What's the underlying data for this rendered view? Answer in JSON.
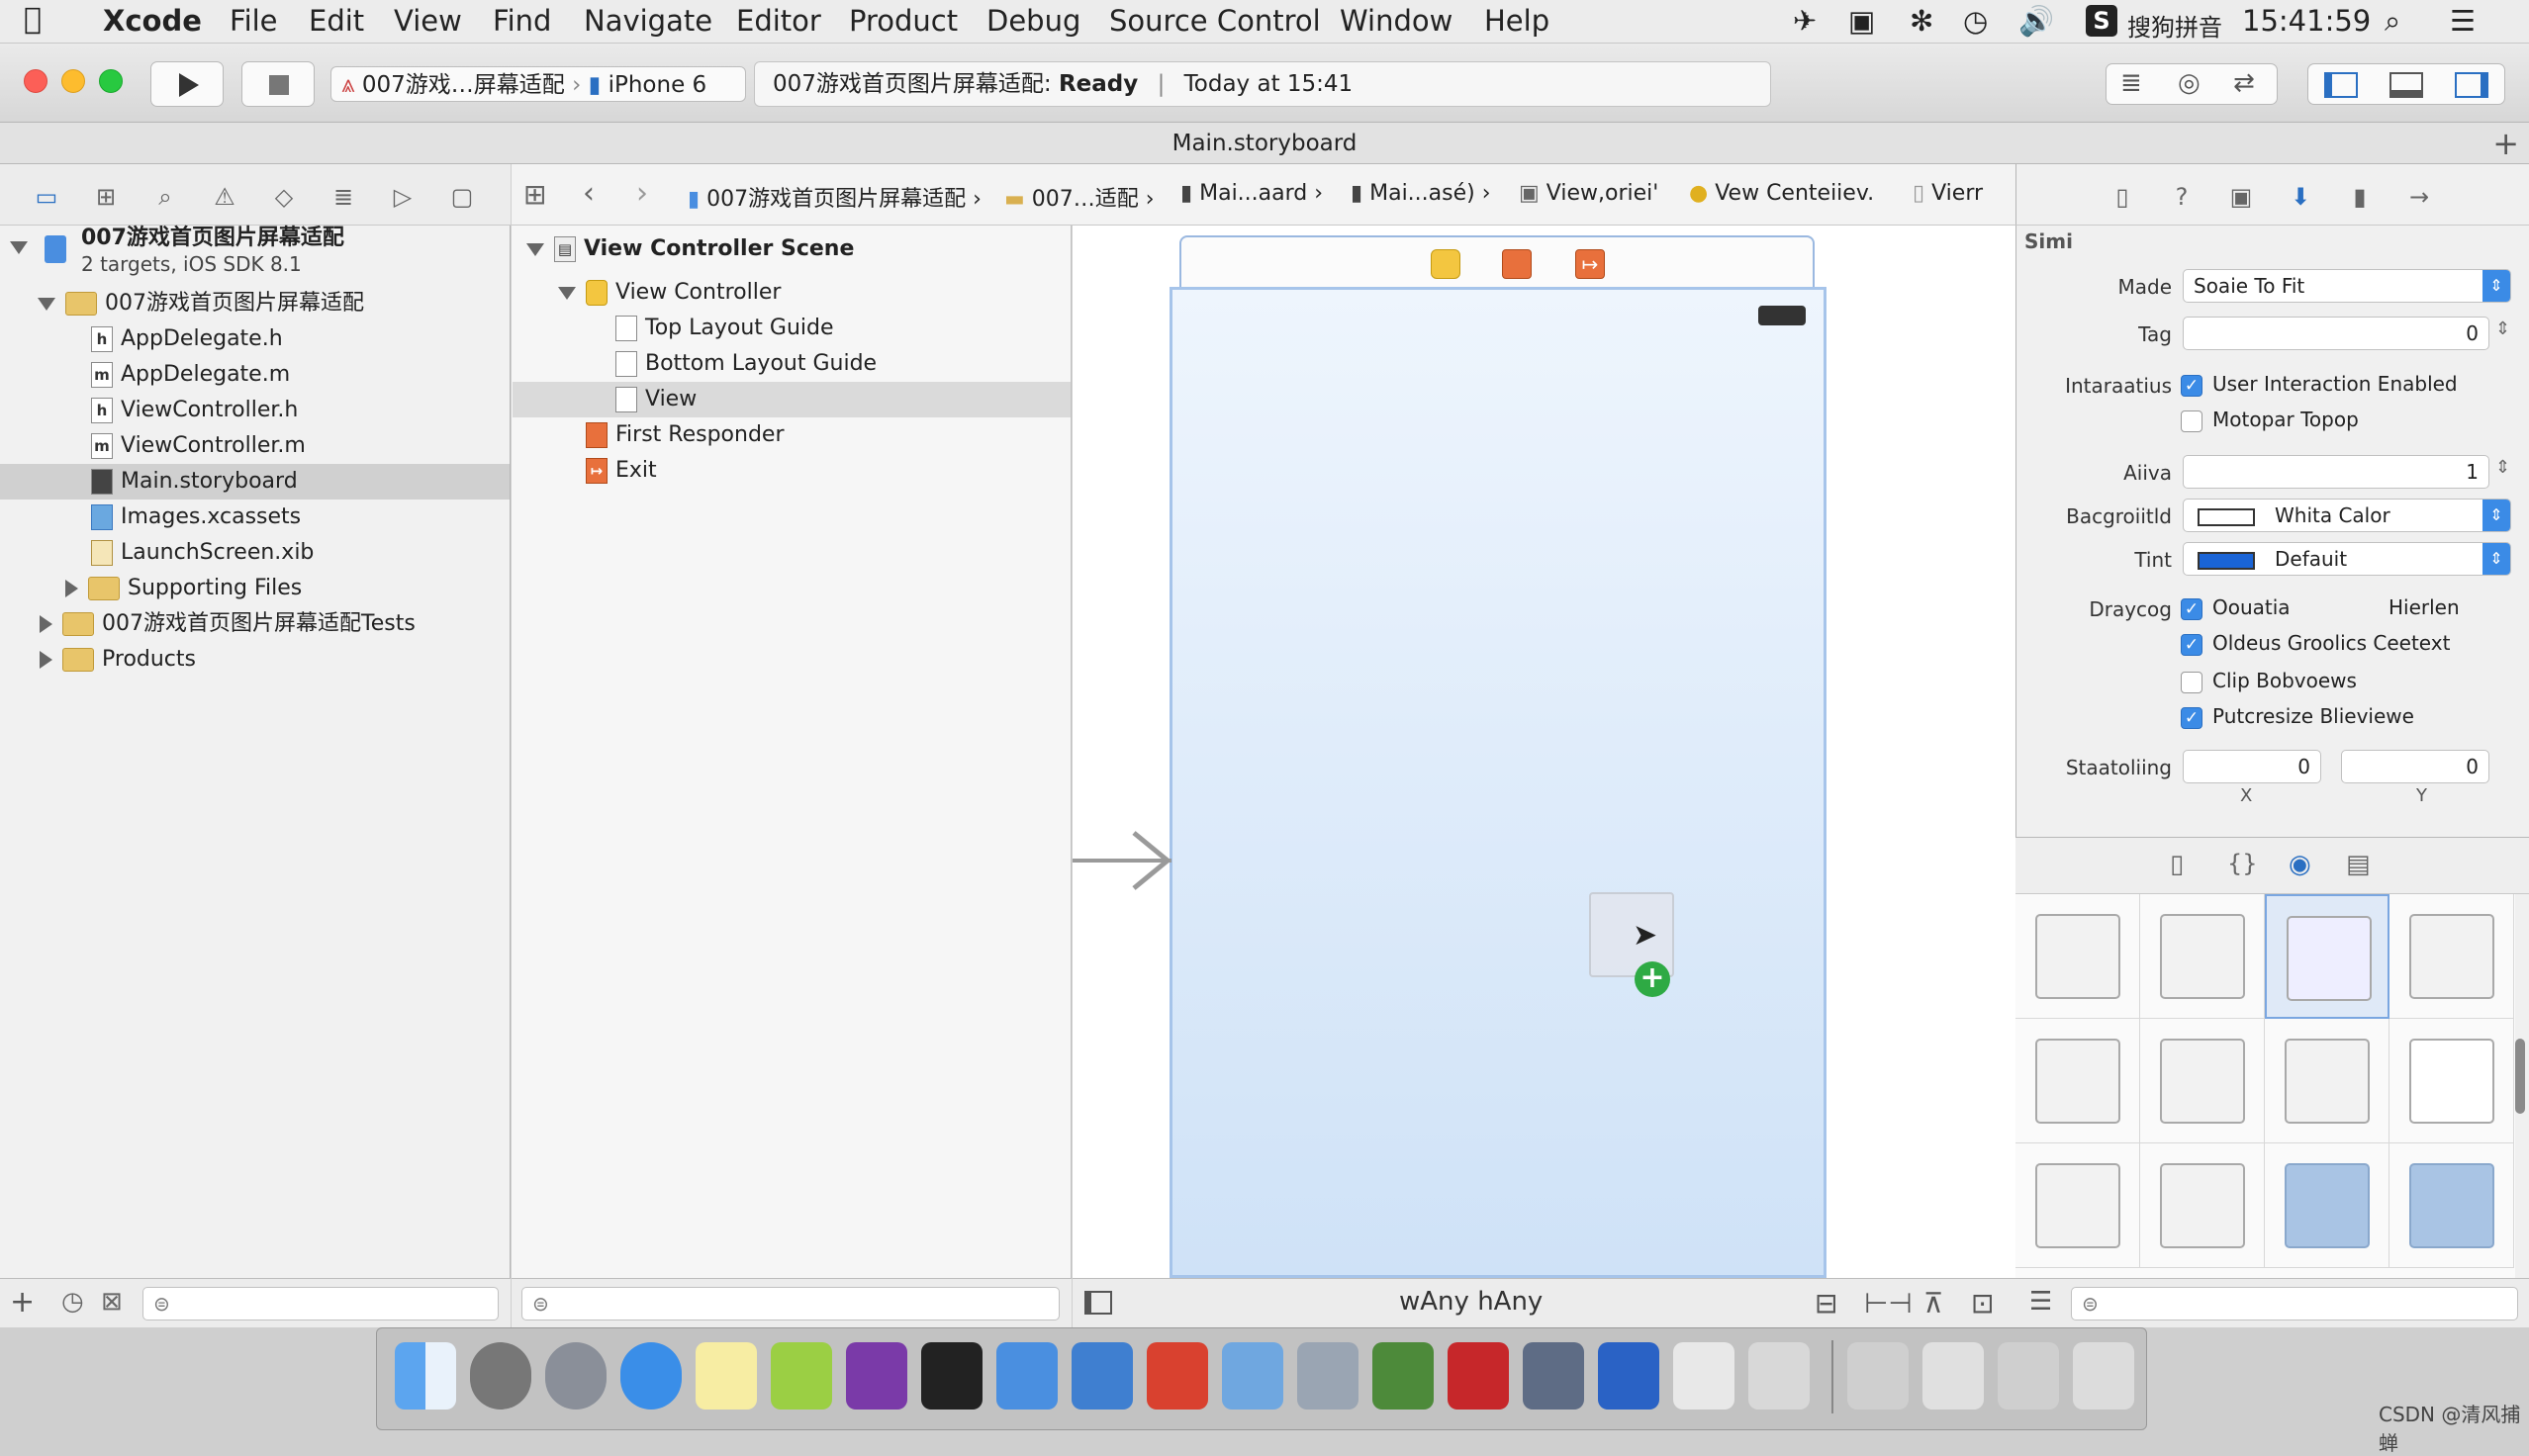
{
  "menubar": {
    "app": "Xcode",
    "items": [
      "File",
      "Edit",
      "View",
      "Find",
      "Navigate",
      "Editor",
      "Product",
      "Debug",
      "Source Control",
      "Window",
      "Help"
    ],
    "input_method": "搜狗拼音",
    "clock": "15:41:59"
  },
  "toolbar": {
    "scheme": "007游戏…屏幕适配",
    "device": "iPhone 6",
    "status_project": "007游戏首页图片屏幕适配:",
    "status_state": "Ready",
    "status_sep": "|",
    "status_time": "Today at 15:41"
  },
  "tab": {
    "title": "Main.storyboard"
  },
  "navigator": {
    "project": {
      "name": "007游戏首页图片屏幕适配",
      "subtitle": "2 targets, iOS SDK 8.1"
    },
    "group": "007游戏首页图片屏幕适配",
    "files": [
      {
        "icon": "h",
        "name": "AppDelegate.h"
      },
      {
        "icon": "m",
        "name": "AppDelegate.m"
      },
      {
        "icon": "h",
        "name": "ViewController.h"
      },
      {
        "icon": "m",
        "name": "ViewController.m"
      },
      {
        "icon": "sb",
        "name": "Main.storyboard"
      },
      {
        "icon": "xc",
        "name": "Images.xcassets"
      },
      {
        "icon": "xib",
        "name": "LaunchScreen.xib"
      }
    ],
    "supporting": "Supporting Files",
    "tests": "007游戏首页图片屏幕适配Tests",
    "products": "Products"
  },
  "jumpbar": {
    "items": [
      "007游戏首页图片屏幕适配",
      "007…适配",
      "Mai...aard",
      "Mai...asé)",
      "View,oriei'",
      "Vew Centeiiev.",
      "Vierr"
    ]
  },
  "outline": {
    "scene": "View Controller Scene",
    "vc": "View Controller",
    "top_guide": "Top Layout Guide",
    "bottom_guide": "Bottom Layout Guide",
    "view": "View",
    "first_responder": "First Responder",
    "exit": "Exit"
  },
  "canvas": {
    "size_class_w": "wAny",
    "size_class_h": "hAny"
  },
  "inspector": {
    "section": "Simi",
    "mode_label": "Made",
    "mode_value": "Soaie To Fit",
    "tag_label": "Tag",
    "tag_value": "0",
    "interaction_label": "Intaraatius",
    "user_interaction": "User Interaction Enabled",
    "multiple_touch": "Motopar Topop",
    "alpha_label": "Aiiva",
    "alpha_value": "1",
    "background_label": "Bacgroiitld",
    "background_value": "Whita Calor",
    "tint_label": "Tint",
    "tint_value": "Defauit",
    "drawing_label": "Draycog",
    "opaque": "Oouatia",
    "hidden": "Hierlen",
    "clears_context": "Oldeus Groolics Ceetext",
    "clip_subviews": "Clip Bobvoews",
    "autoresize": "Putcresize Blieviewe",
    "stretching_label": "Staatoliing",
    "stretch_x_value": "0",
    "stretch_y_value": "0",
    "x_label": "X",
    "y_label": "Y",
    "accent": "#3b8be6",
    "tint_color": "#1a64d6"
  },
  "watermark": "CSDN @清风捕蝉"
}
